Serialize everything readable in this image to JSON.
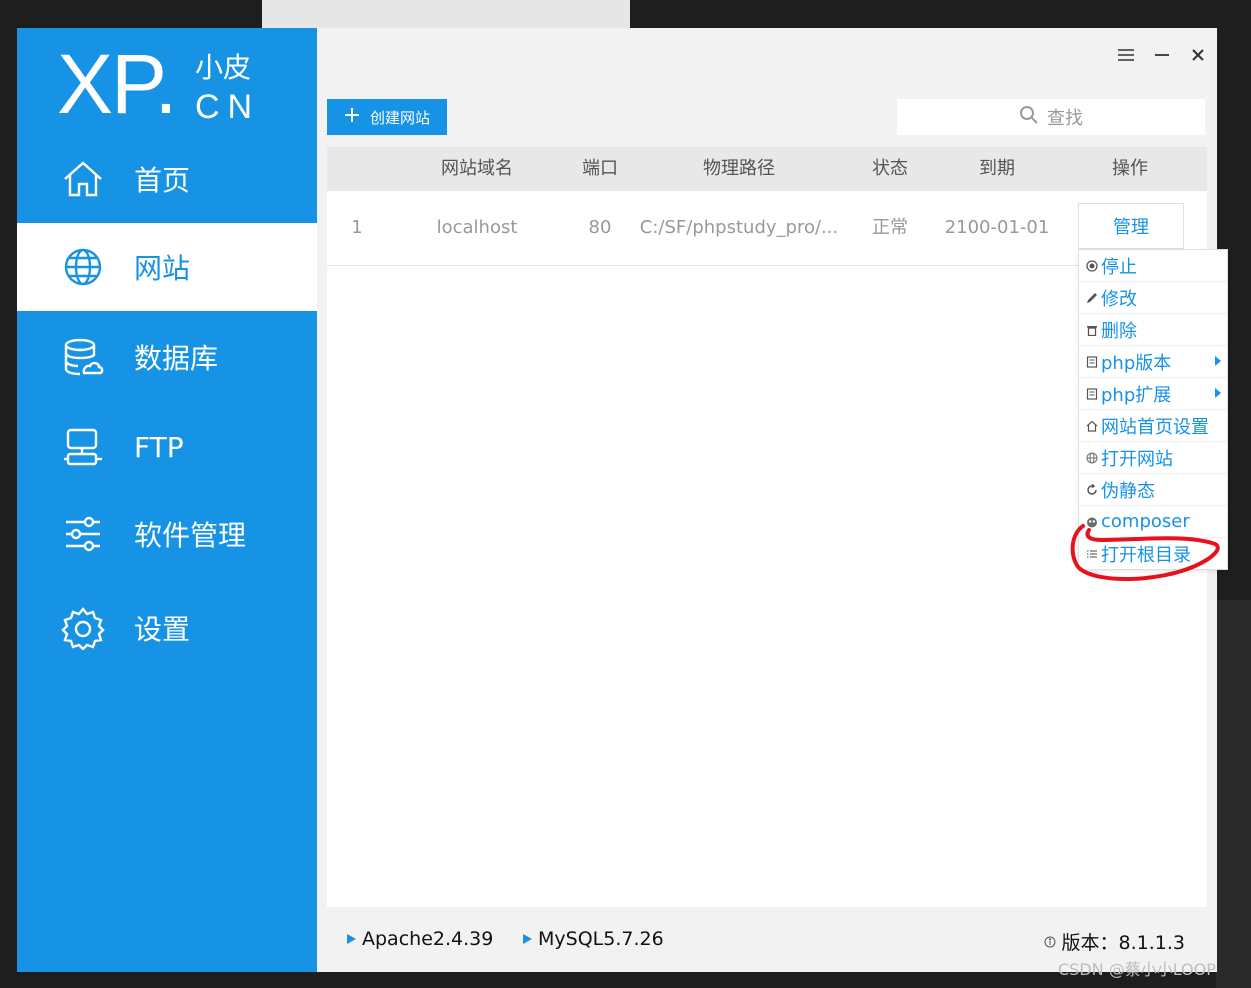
{
  "logo": {
    "xp": "XP.",
    "cn_top": "小皮",
    "cn_bottom": "CN"
  },
  "sidebar": {
    "items": [
      {
        "label": "首页",
        "icon": "home-icon",
        "active": false
      },
      {
        "label": "网站",
        "icon": "globe-icon",
        "active": true
      },
      {
        "label": "数据库",
        "icon": "database-icon",
        "active": false
      },
      {
        "label": "FTP",
        "icon": "ftp-icon",
        "active": false
      },
      {
        "label": "软件管理",
        "icon": "sliders-icon",
        "active": false
      },
      {
        "label": "设置",
        "icon": "gear-icon",
        "active": false
      }
    ]
  },
  "toolbar": {
    "create_label": "创建网站",
    "search_placeholder": "查找"
  },
  "table": {
    "headers": [
      "网站域名",
      "端口",
      "物理路径",
      "状态",
      "到期",
      "操作"
    ],
    "rows": [
      {
        "index": "1",
        "domain": "localhost",
        "port": "80",
        "path": "C:/SF/phpstudy_pro/...",
        "status": "正常",
        "expire": "2100-01-01",
        "action": "管理"
      }
    ]
  },
  "context_menu": {
    "items": [
      {
        "label": "停止",
        "icon": "stop-icon",
        "submenu": false
      },
      {
        "label": "修改",
        "icon": "pencil-icon",
        "submenu": false
      },
      {
        "label": "删除",
        "icon": "trash-icon",
        "submenu": false
      },
      {
        "label": "php版本",
        "icon": "php-version-icon",
        "submenu": true
      },
      {
        "label": "php扩展",
        "icon": "php-extension-icon",
        "submenu": true
      },
      {
        "label": "网站首页设置",
        "icon": "home-small-icon",
        "submenu": false
      },
      {
        "label": "打开网站",
        "icon": "globe-small-icon",
        "submenu": false
      },
      {
        "label": "伪静态",
        "icon": "refresh-icon",
        "submenu": false
      },
      {
        "label": "composer",
        "icon": "composer-icon",
        "submenu": false
      },
      {
        "label": "打开根目录",
        "icon": "list-icon",
        "submenu": false
      }
    ]
  },
  "footer": {
    "apache": "Apache2.4.39",
    "mysql": "MySQL5.7.26",
    "version": "版本：8.1.1.3"
  },
  "watermark": "CSDN @蔡小小LOOP",
  "colors": {
    "brand": "#1793e5",
    "annotation": "#e8101c"
  }
}
